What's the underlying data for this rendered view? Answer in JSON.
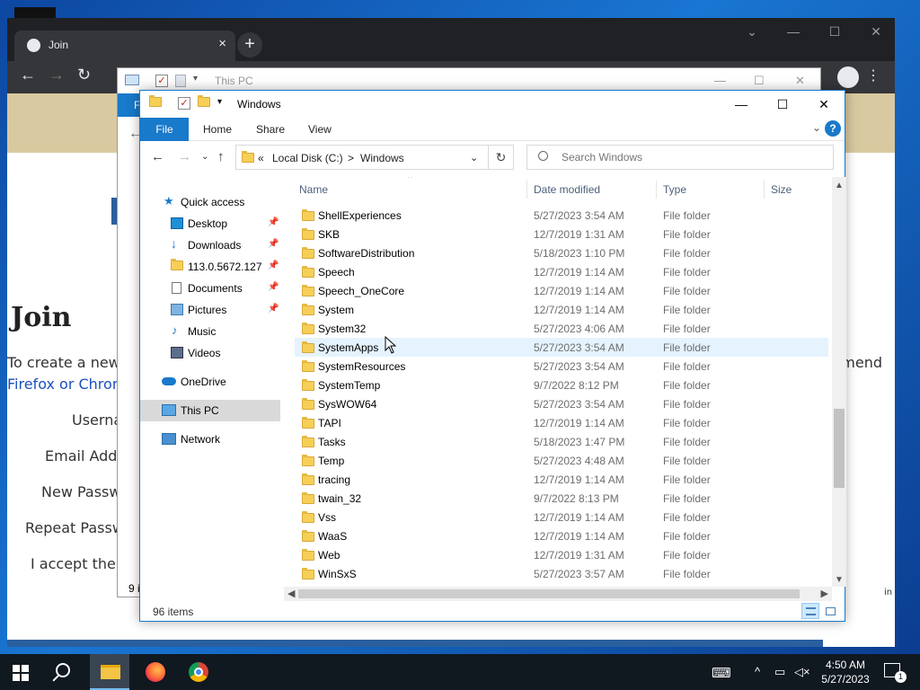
{
  "browser": {
    "tab_title": "Join",
    "new_tab": "+",
    "page": {
      "heading": "Join",
      "intro_text": "To create a new",
      "intro_link": "Firefox or Chron",
      "intro_tail": "mend",
      "form_labels": [
        "Userna",
        "Email Addr",
        "New Passw",
        "Repeat Passw",
        "I accept the"
      ],
      "side_fragment": "in"
    }
  },
  "bg_explorer": {
    "title": "This PC",
    "ribbon_file": "F",
    "item_count": "9 i"
  },
  "explorer": {
    "title": "Windows",
    "ribbon": {
      "file": "File",
      "tabs": [
        "Home",
        "Share",
        "View"
      ],
      "help": "?"
    },
    "address": {
      "prefix": "«",
      "crumbs": [
        "Local Disk (C:)",
        "Windows"
      ],
      "sep": ">"
    },
    "search": {
      "placeholder": "Search Windows"
    },
    "nav": {
      "quick_access": "Quick access",
      "items": [
        {
          "label": "Desktop",
          "icon": "desktop-icon",
          "pinned": true
        },
        {
          "label": "Downloads",
          "icon": "downloads-icon",
          "pinned": true
        },
        {
          "label": "113.0.5672.127",
          "icon": "folder-icon",
          "pinned": true
        },
        {
          "label": "Documents",
          "icon": "documents-icon",
          "pinned": true
        },
        {
          "label": "Pictures",
          "icon": "pictures-icon",
          "pinned": true
        },
        {
          "label": "Music",
          "icon": "music-icon",
          "pinned": false
        },
        {
          "label": "Videos",
          "icon": "videos-icon",
          "pinned": false
        }
      ],
      "onedrive": "OneDrive",
      "this_pc": "This PC",
      "network": "Network"
    },
    "columns": {
      "name": "Name",
      "date": "Date modified",
      "type": "Type",
      "size": "Size"
    },
    "files": [
      {
        "name": "ShellExperiences",
        "date": "5/27/2023 3:54 AM",
        "type": "File folder"
      },
      {
        "name": "SKB",
        "date": "12/7/2019 1:31 AM",
        "type": "File folder"
      },
      {
        "name": "SoftwareDistribution",
        "date": "5/18/2023 1:10 PM",
        "type": "File folder"
      },
      {
        "name": "Speech",
        "date": "12/7/2019 1:14 AM",
        "type": "File folder"
      },
      {
        "name": "Speech_OneCore",
        "date": "12/7/2019 1:14 AM",
        "type": "File folder"
      },
      {
        "name": "System",
        "date": "12/7/2019 1:14 AM",
        "type": "File folder"
      },
      {
        "name": "System32",
        "date": "5/27/2023 4:06 AM",
        "type": "File folder"
      },
      {
        "name": "SystemApps",
        "date": "5/27/2023 3:54 AM",
        "type": "File folder"
      },
      {
        "name": "SystemResources",
        "date": "5/27/2023 3:54 AM",
        "type": "File folder"
      },
      {
        "name": "SystemTemp",
        "date": "9/7/2022 8:12 PM",
        "type": "File folder"
      },
      {
        "name": "SysWOW64",
        "date": "5/27/2023 3:54 AM",
        "type": "File folder"
      },
      {
        "name": "TAPI",
        "date": "12/7/2019 1:14 AM",
        "type": "File folder"
      },
      {
        "name": "Tasks",
        "date": "5/18/2023 1:47 PM",
        "type": "File folder"
      },
      {
        "name": "Temp",
        "date": "5/27/2023 4:48 AM",
        "type": "File folder"
      },
      {
        "name": "tracing",
        "date": "12/7/2019 1:14 AM",
        "type": "File folder"
      },
      {
        "name": "twain_32",
        "date": "9/7/2022 8:13 PM",
        "type": "File folder"
      },
      {
        "name": "Vss",
        "date": "12/7/2019 1:14 AM",
        "type": "File folder"
      },
      {
        "name": "WaaS",
        "date": "12/7/2019 1:14 AM",
        "type": "File folder"
      },
      {
        "name": "Web",
        "date": "12/7/2019 1:31 AM",
        "type": "File folder"
      },
      {
        "name": "WinSxS",
        "date": "5/27/2023 3:57 AM",
        "type": "File folder"
      }
    ],
    "hovered_row": "SystemApps",
    "status": "96 items"
  },
  "taskbar": {
    "time": "4:50 AM",
    "date": "5/27/2023",
    "notification_count": "1"
  },
  "colors": {
    "accent": "#1979ca",
    "folder": "#f6cf57",
    "hover": "#e5f3ff",
    "taskbar": "#101820"
  }
}
